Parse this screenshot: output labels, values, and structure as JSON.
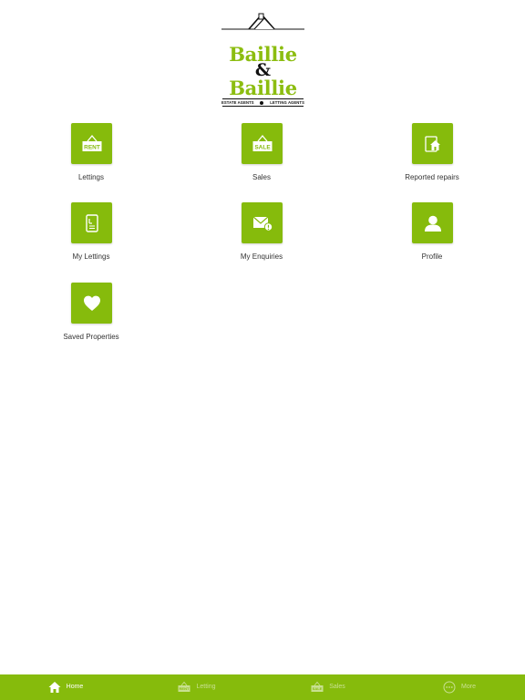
{
  "logo": {
    "line1": "Baillie",
    "ampersand": "&",
    "line2": "Baillie",
    "tag_left": "ESTATE AGENTS",
    "tag_right": "LETTING AGENTS",
    "brand_color": "#86bb0c"
  },
  "grid": {
    "tiles": [
      {
        "label": "Lettings",
        "icon": "rent-sign-icon",
        "sign_text": "RENT"
      },
      {
        "label": "Sales",
        "icon": "sale-sign-icon",
        "sign_text": "SALE"
      },
      {
        "label": "Reported repairs",
        "icon": "house-repair-icon"
      },
      {
        "label": "My Lettings",
        "icon": "document-icon"
      },
      {
        "label": "My Enquiries",
        "icon": "envelope-icon"
      },
      {
        "label": "Profile",
        "icon": "person-icon"
      },
      {
        "label": "Saved Properties",
        "icon": "heart-icon"
      }
    ]
  },
  "tabbar": {
    "background": "#86bb0c",
    "tabs": [
      {
        "label": "Home",
        "icon": "home-icon",
        "active": true
      },
      {
        "label": "Letting",
        "icon": "rent-sign-icon",
        "sign_text": "RENT",
        "active": false
      },
      {
        "label": "Sales",
        "icon": "sale-sign-icon",
        "sign_text": "SALE",
        "active": false
      },
      {
        "label": "More",
        "icon": "more-icon",
        "active": false
      }
    ]
  }
}
